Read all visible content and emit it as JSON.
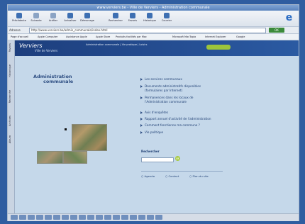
{
  "window": {
    "title": "www.verviers.be - Ville de Verviers - Administration communale"
  },
  "toolbar": {
    "buttons": [
      {
        "label": "Précédente"
      },
      {
        "label": "Suivante"
      },
      {
        "label": "Arrêter"
      },
      {
        "label": "Actualiser"
      },
      {
        "label": "Démarrage"
      },
      {
        "label": "Rechercher"
      },
      {
        "label": "Favoris"
      },
      {
        "label": "Historique"
      },
      {
        "label": "Courrier"
      }
    ]
  },
  "address": {
    "label": "Adresse",
    "url": "http://www.verviers.be/admin_communale/index.html",
    "go_label": "OK"
  },
  "links": [
    "Page d'accueil",
    "Apple Computer",
    "Assistance Apple",
    "Apple Store",
    "Produits facilités par Mac",
    "Microsoft MacTopia",
    "Internet Explorer",
    "Google"
  ],
  "sidebar": {
    "tabs": [
      "Favoris",
      "Historique",
      "Recherche",
      "Archives",
      "Album"
    ]
  },
  "site": {
    "logo_name": "Verviers",
    "logo_sub": "Ville de Verviers",
    "nav": "Administration communale  |  Vie pratique  |  Loisirs"
  },
  "page": {
    "title_line1": "Administration",
    "title_line2": "communale",
    "menu": [
      "Les services communaux",
      "Documents administratifs disponibles",
      "(formulaires par Internet)",
      "Permanences dans les locaux de",
      "l'Administration communale",
      "Avis d'enquêtes",
      "Rapport annuel d'activité de l'administration",
      "Comment fonctionne ma commune ?",
      "Vie politique"
    ],
    "search": {
      "label": "Rechercher",
      "placeholder": "",
      "go": "ok"
    },
    "footer": [
      "Agenda",
      "Contact",
      "Plan du site"
    ]
  }
}
